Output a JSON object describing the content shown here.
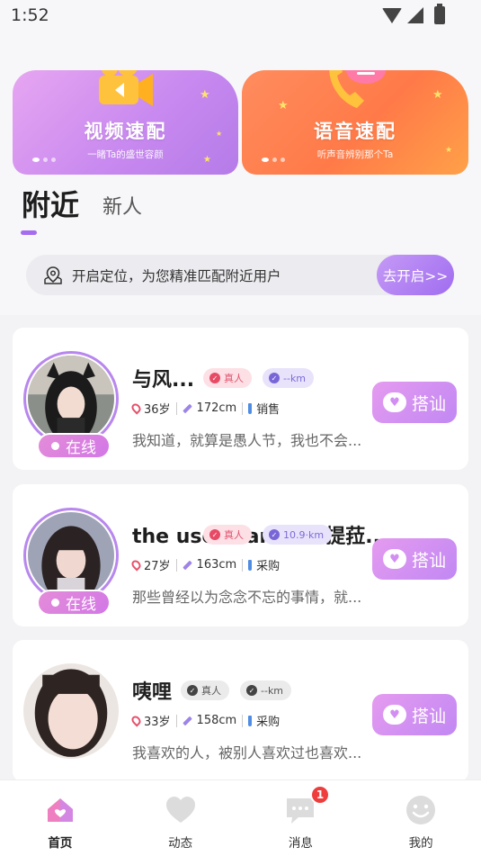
{
  "status_bar": {
    "time": "1:52"
  },
  "banners": [
    {
      "title": "视频速配",
      "subtitle": "一睹Ta的盛世容颜",
      "icon": "video-camera-icon"
    },
    {
      "title": "语音速配",
      "subtitle": "听声音辨别那个Ta",
      "icon": "phone-chat-icon"
    }
  ],
  "tabs": {
    "active": "附近",
    "inactive": "新人"
  },
  "location": {
    "text": "开启定位，为您精准匹配附近用户",
    "button": "去开启>>"
  },
  "users": [
    {
      "name": "与风...",
      "real_badge": "真人",
      "distance": "--km",
      "online": "在线",
      "age": "36岁",
      "height": "172cm",
      "job": "销售",
      "bio": "我知道，就算是愚人节，我也不会...",
      "action": "搭讪"
    },
    {
      "name": "the user name is 提菈...",
      "real_badge": "真人",
      "distance": "10.9·km",
      "online": "在线",
      "age": "27岁",
      "height": "163cm",
      "job": "采购",
      "bio": "那些曾经以为念念不忘的事情，就...",
      "action": "搭讪"
    },
    {
      "name": "咦哩",
      "real_badge": "真人",
      "distance": "--km",
      "online": "",
      "age": "33岁",
      "height": "158cm",
      "job": "采购",
      "bio": "我喜欢的人，被别人喜欢过也喜欢...",
      "action": "搭讪"
    }
  ],
  "nav": {
    "items": [
      {
        "label": "首页",
        "icon": "home-icon"
      },
      {
        "label": "动态",
        "icon": "heart-icon"
      },
      {
        "label": "消息",
        "icon": "message-icon"
      },
      {
        "label": "我的",
        "icon": "smile-icon"
      }
    ],
    "message_badge": "1"
  },
  "colors": {
    "accent": "#a66cf0",
    "video_banner": "#c98af0",
    "voice_banner": "#ff7a48",
    "online": "#d277e6"
  }
}
